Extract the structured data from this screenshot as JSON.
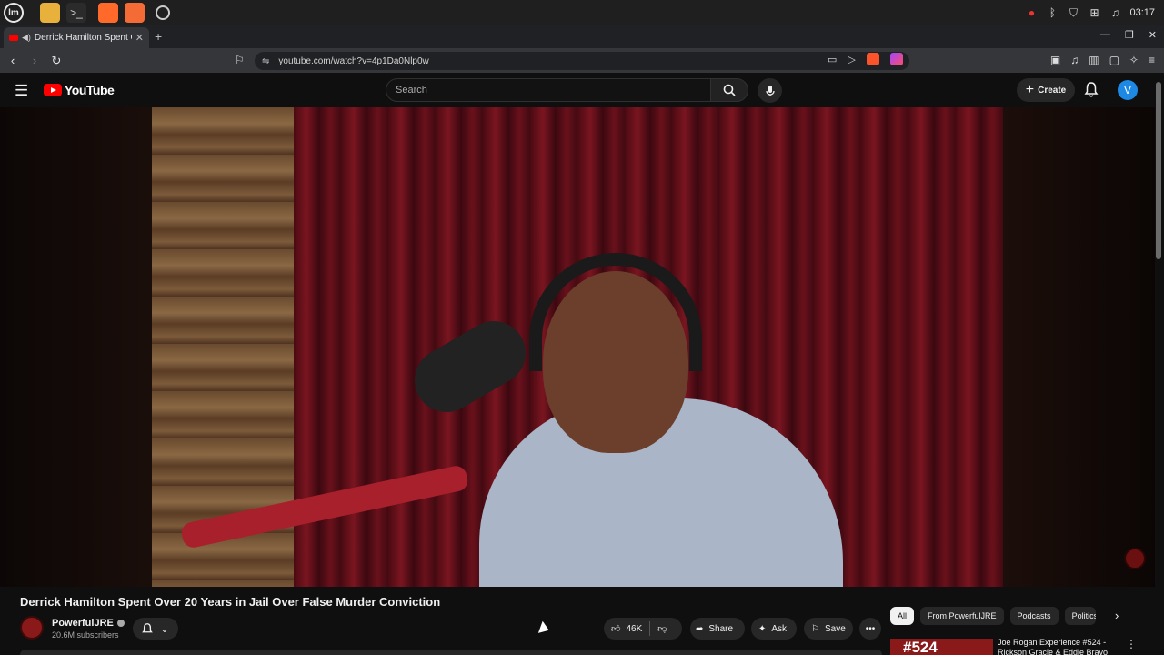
{
  "taskbar": {
    "clock": "03:17",
    "apps": [
      "files-app",
      "terminal-app",
      "firefox-app",
      "brave-app",
      "other-app"
    ]
  },
  "browser": {
    "tab_title": "Derrick Hamilton Spent Ov",
    "url": "youtube.com/watch?v=4p1Da0Nlp0w",
    "new_tab_label": "+"
  },
  "youtube": {
    "logo_text": "YouTube",
    "search_placeholder": "Search",
    "create_label": "Create",
    "avatar_letter": "V"
  },
  "video": {
    "title": "Derrick Hamilton Spent Over 20 Years in Jail Over False Murder Conviction",
    "channel_name": "PowerfulJRE",
    "subscribers": "20.6M subscribers",
    "likes": "46K",
    "share_label": "Share",
    "ask_label": "Ask",
    "save_label": "Save"
  },
  "chips": [
    "All",
    "From PowerfulJRE",
    "Podcasts",
    "Politics"
  ],
  "recommended": {
    "thumb_text": "#524",
    "title": "Joe Rogan Experience #524 - Rickson Gracie & Eddie Bravo"
  },
  "colors": {
    "yt_red": "#ff0000",
    "bg": "#0f0f0f",
    "avatar_blue": "#1e88e5"
  }
}
